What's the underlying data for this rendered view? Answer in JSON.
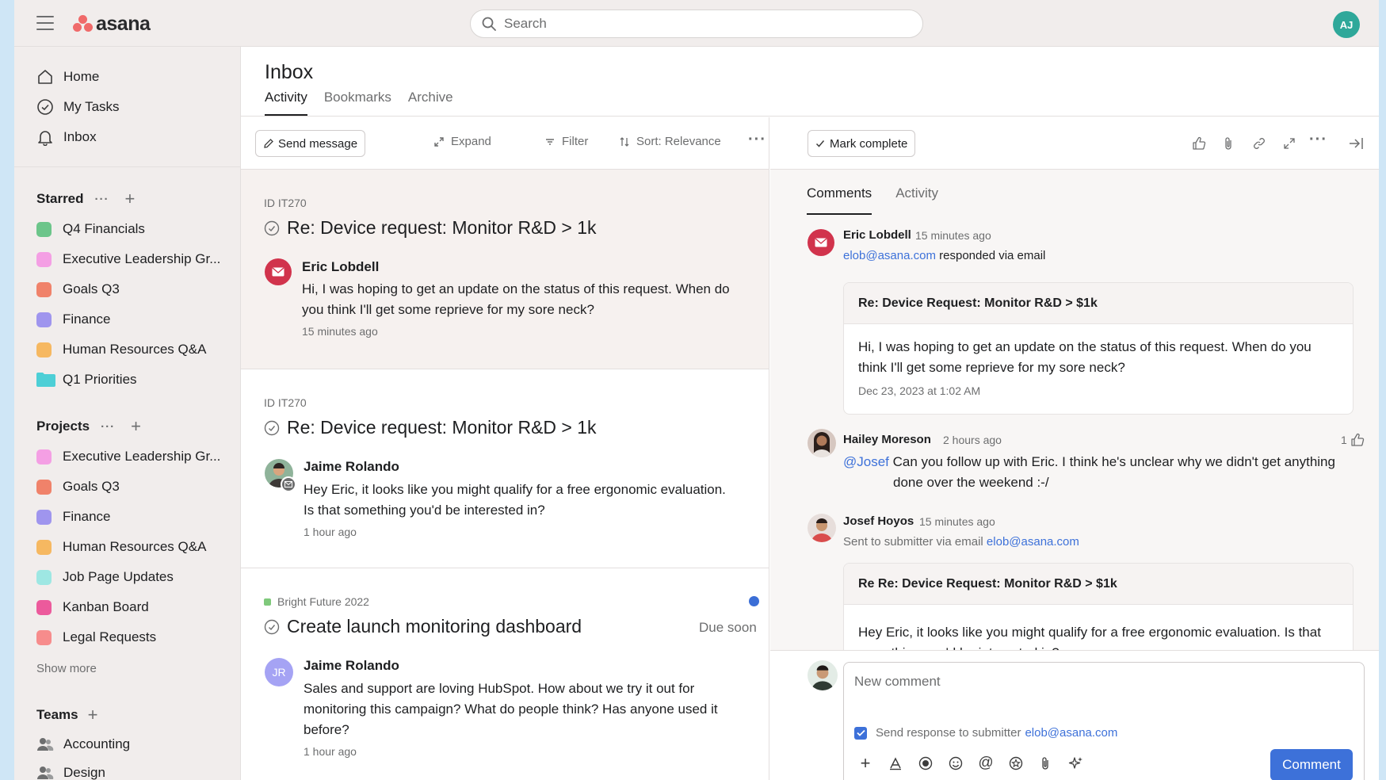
{
  "app": {
    "logo_text": "asana",
    "brand_color": "#f06a6a"
  },
  "search": {
    "placeholder": "Search"
  },
  "user": {
    "initials": "AJ",
    "color": "#2fa89a"
  },
  "nav": [
    {
      "label": "Home",
      "icon": "home-icon"
    },
    {
      "label": "My Tasks",
      "icon": "check-circle-icon"
    },
    {
      "label": "Inbox",
      "icon": "bell-icon"
    }
  ],
  "starred": {
    "heading": "Starred",
    "items": [
      {
        "label": "Q4 Financials",
        "color": "#6cc58a"
      },
      {
        "label": "Executive Leadership Gr...",
        "color": "#f49fe4"
      },
      {
        "label": "Goals Q3",
        "color": "#f0826a"
      },
      {
        "label": "Finance",
        "color": "#9f95ee"
      },
      {
        "label": "Human Resources Q&A",
        "color": "#f6b861"
      },
      {
        "label": "Q1 Priorities",
        "color": "#4dcfd6",
        "icon": "folder-icon"
      }
    ]
  },
  "projects": {
    "heading": "Projects",
    "items": [
      {
        "label": "Executive Leadership Gr...",
        "color": "#f49fe4"
      },
      {
        "label": "Goals Q3",
        "color": "#f0826a"
      },
      {
        "label": "Finance",
        "color": "#9f95ee"
      },
      {
        "label": "Human Resources Q&A",
        "color": "#f6b861"
      },
      {
        "label": "Job Page Updates",
        "color": "#9ee7e3"
      },
      {
        "label": "Kanban Board",
        "color": "#ec5a9c"
      },
      {
        "label": "Legal Requests",
        "color": "#f78c8c"
      }
    ],
    "show_more": "Show more"
  },
  "teams": {
    "heading": "Teams",
    "items": [
      {
        "label": "Accounting"
      },
      {
        "label": "Design"
      }
    ]
  },
  "inbox": {
    "title": "Inbox",
    "tabs": [
      "Activity",
      "Bookmarks",
      "Archive"
    ],
    "toolbar": {
      "send_message": "Send message",
      "expand": "Expand",
      "filter": "Filter",
      "sort": "Sort: Relevance"
    }
  },
  "messages": [
    {
      "id": "ID IT270",
      "title": "Re: Device request: Monitor R&D > 1k",
      "author": "Eric Lobdell",
      "body_line1": "Hi, I was hoping to get an update on the status of this request. When do",
      "body_line2": "you think I'll get some reprieve for my sore neck?",
      "time": "15 minutes ago"
    },
    {
      "id": "ID IT270",
      "title": "Re: Device request: Monitor R&D > 1k",
      "author": "Jaime Rolando",
      "body_line1": "Hey Eric, it looks like you might qualify for a free ergonomic evaluation.",
      "body_line2": "Is that something you'd be interested in?",
      "time": "1 hour ago"
    },
    {
      "project": "Bright Future 2022",
      "title": "Create launch monitoring dashboard",
      "due": "Due soon",
      "author": "Jaime Rolando",
      "author_initials": "JR",
      "body_line1": "Sales and support are loving HubSpot. How about we try it out for",
      "body_line2": "monitoring this campaign? What do people think? Has anyone used it",
      "body_line3": "before?",
      "time": "1 hour ago"
    }
  ],
  "detail": {
    "mark_complete": "Mark complete",
    "tabs": [
      "Comments",
      "Activity"
    ],
    "comments": [
      {
        "author": "Eric Lobdell",
        "time": "15 minutes ago",
        "email": "elob@asana.com",
        "action": "responded via email",
        "email_subject": "Re: Device Request: Monitor R&D > $1k",
        "email_line1": "Hi, I was hoping to get an update on the status of this request. When do you",
        "email_line2": "think I'll get some reprieve for my sore neck?",
        "email_date": "Dec 23, 2023 at 1:02 AM"
      },
      {
        "author": "Hailey Moreson",
        "time": "2 hours ago",
        "likes": "1",
        "mention": "@Josef",
        "line1": "Can you follow up with Eric. I think he's unclear why we didn't get anything",
        "line2": "done over the weekend :-/"
      },
      {
        "author": "Josef Hoyos",
        "time": "15 minutes ago",
        "action": "Sent to submitter via email",
        "email": "elob@asana.com",
        "email_subject": "Re Re: Device Request: Monitor R&D > $1k",
        "email_line1": "Hey Eric, it looks like you might qualify for a free ergonomic evaluation. Is that",
        "email_line2": "something you'd be interested in?"
      }
    ],
    "composer": {
      "placeholder": "New comment",
      "send_response": "Send response to submitter",
      "email": "elob@asana.com",
      "button": "Comment"
    }
  }
}
